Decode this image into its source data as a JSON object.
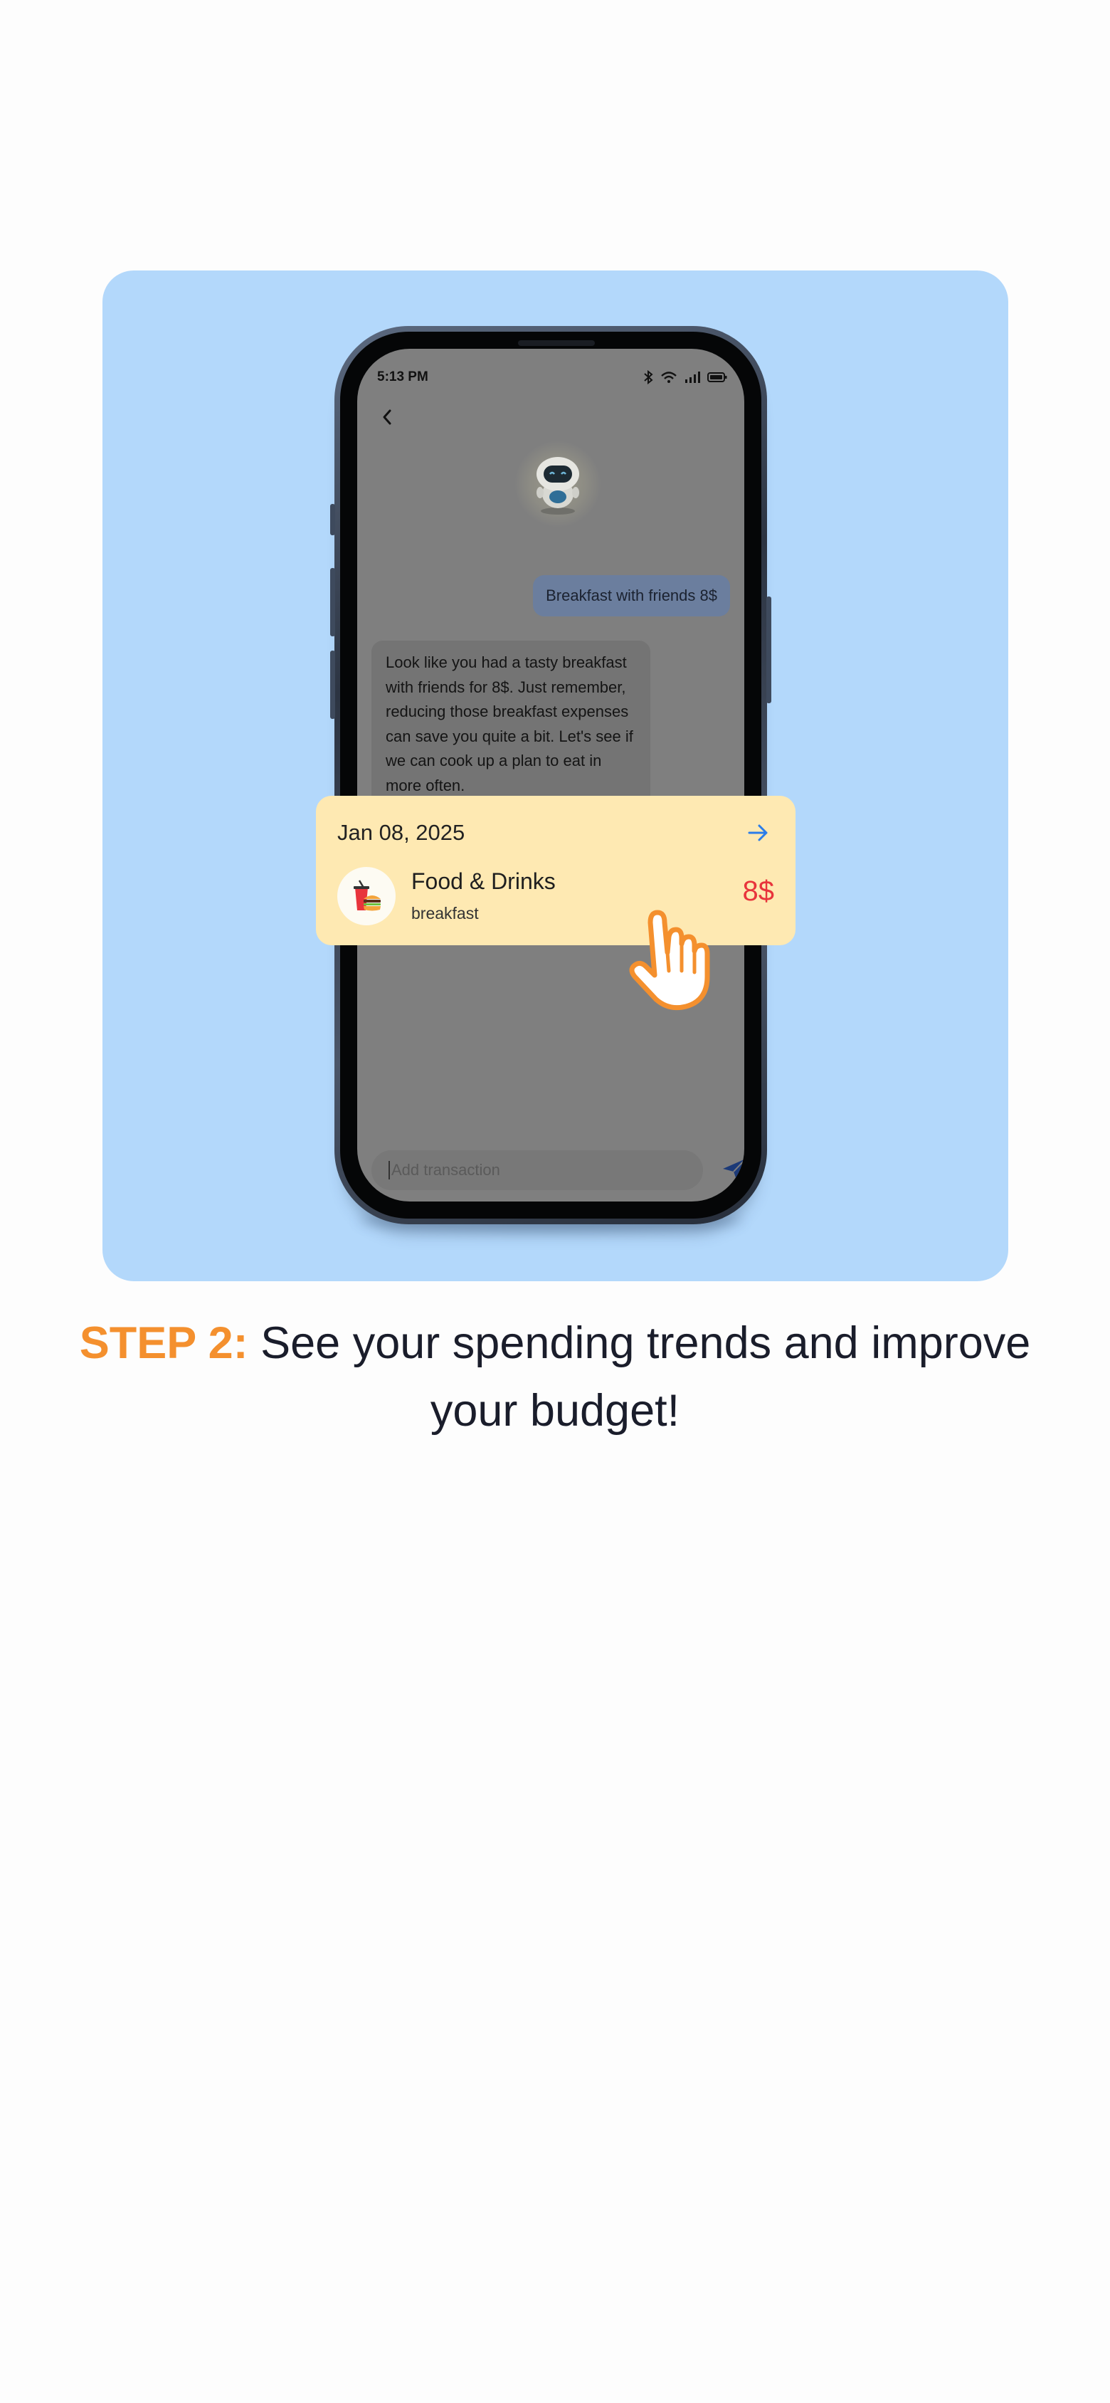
{
  "phone": {
    "status_time": "5:13 PM",
    "user_message": "Breakfast with friends 8$",
    "bot_message": "Look like you had a tasty breakfast with friends for 8$. Just remember, reducing those breakfast expenses can save you quite a bit. Let's see if we can cook up a plan to eat in more often.",
    "input_placeholder": "Add transaction"
  },
  "card": {
    "date": "Jan 08, 2025",
    "category": "Food & Drinks",
    "note": "breakfast",
    "amount": "8$"
  },
  "caption": {
    "step_label": "STEP 2:",
    "text": " See your spending trends and improve your budget!"
  },
  "colors": {
    "hero_background": "#b3d8fb",
    "card_background": "#fee9b2",
    "accent_orange": "#f4902e",
    "amount_red": "#e8343c",
    "arrow_blue": "#2b7de9"
  },
  "icons": [
    "back-chevron-icon",
    "robot-avatar-icon",
    "send-icon",
    "arrow-right-icon",
    "food-drinks-icon",
    "tap-hand-icon",
    "bluetooth-icon",
    "wifi-icon",
    "signal-icon",
    "battery-icon"
  ]
}
